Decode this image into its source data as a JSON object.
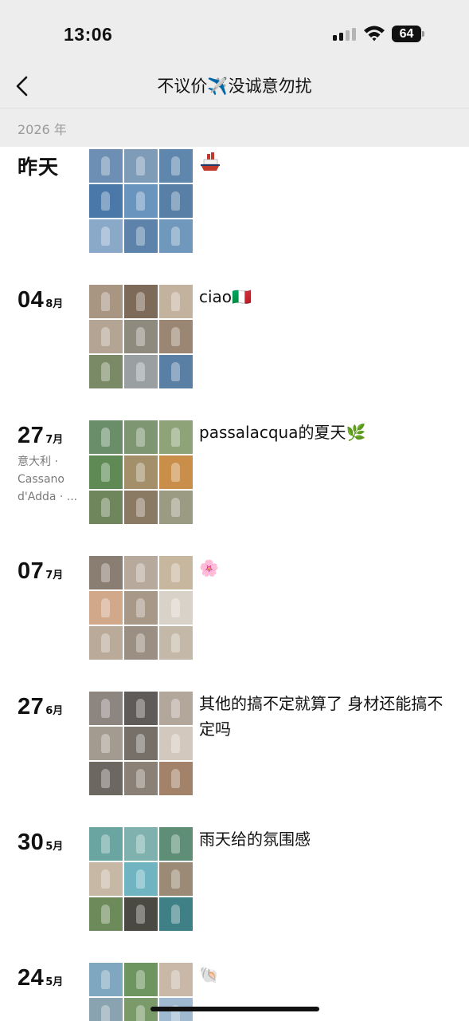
{
  "status_bar": {
    "time": "13:06",
    "battery": "64"
  },
  "nav": {
    "title": "不议价✈️没诚意勿扰"
  },
  "year": "2026 年",
  "posts": [
    {
      "date_word": "昨天",
      "caption": "🚢",
      "caption_icon": "ship-icon",
      "photo_colors": [
        "#6d8fb3",
        "#7e9cb8",
        "#5f87ad",
        "#4a78a8",
        "#6994be",
        "#587fa6",
        "#8aa8c8",
        "#5d83aa",
        "#7098bd"
      ]
    },
    {
      "day": "04",
      "month": "8月",
      "caption": "ciao🇮🇹",
      "caption_icon": "italy-flag-icon",
      "photo_colors": [
        "#a89683",
        "#7d6a58",
        "#c3b29e",
        "#b3a493",
        "#8e8a7e",
        "#9a8672",
        "#7b8a66",
        "#9aa0a2",
        "#5a7fa5"
      ]
    },
    {
      "day": "27",
      "month": "7月",
      "location": "意大利 · Cassano d'Adda · ...",
      "caption": "passalacqua的夏天🌿",
      "caption_icon": "leaf-icon",
      "photo_colors": [
        "#6a8e6a",
        "#7e9672",
        "#8ea478",
        "#5f8a55",
        "#a38f6a",
        "#c98e4a",
        "#6f855b",
        "#8b7a63",
        "#9b9a83"
      ]
    },
    {
      "day": "07",
      "month": "7月",
      "caption": "🌸",
      "caption_icon": "cherry-blossom-icon",
      "photo_colors": [
        "#8a7d72",
        "#b7aa9c",
        "#c8b79f",
        "#d1a88a",
        "#a89888",
        "#d9d2c8",
        "#b9aa99",
        "#9b8e82",
        "#c4b8a8"
      ]
    },
    {
      "day": "27",
      "month": "6月",
      "caption": "其他的搞不定就算了 身材还能搞不定吗",
      "caption_icon": "",
      "photo_colors": [
        "#8c8580",
        "#5e5b58",
        "#b3a79b",
        "#a39a90",
        "#777069",
        "#d2c8be",
        "#6d6761",
        "#8b8075",
        "#a2836a"
      ]
    },
    {
      "day": "30",
      "month": "5月",
      "caption": "雨天给的氛围感",
      "caption_icon": "",
      "photo_colors": [
        "#6aa5a2",
        "#7fb2ae",
        "#5e8f76",
        "#c7b8a5",
        "#6fb4c0",
        "#9a8a76",
        "#6d8a5a",
        "#4b4a42",
        "#3f7f86"
      ]
    },
    {
      "day": "24",
      "month": "5月",
      "caption": "🐚",
      "caption_icon": "shell-icon",
      "photo_colors": [
        "#7fa7bf",
        "#6e9560",
        "#c9b8a8",
        "#8aa3b0",
        "#7a9a6a",
        "#9fbad0",
        "#b2a08a",
        "#8c9a7a",
        "#a8b8c0"
      ]
    }
  ]
}
